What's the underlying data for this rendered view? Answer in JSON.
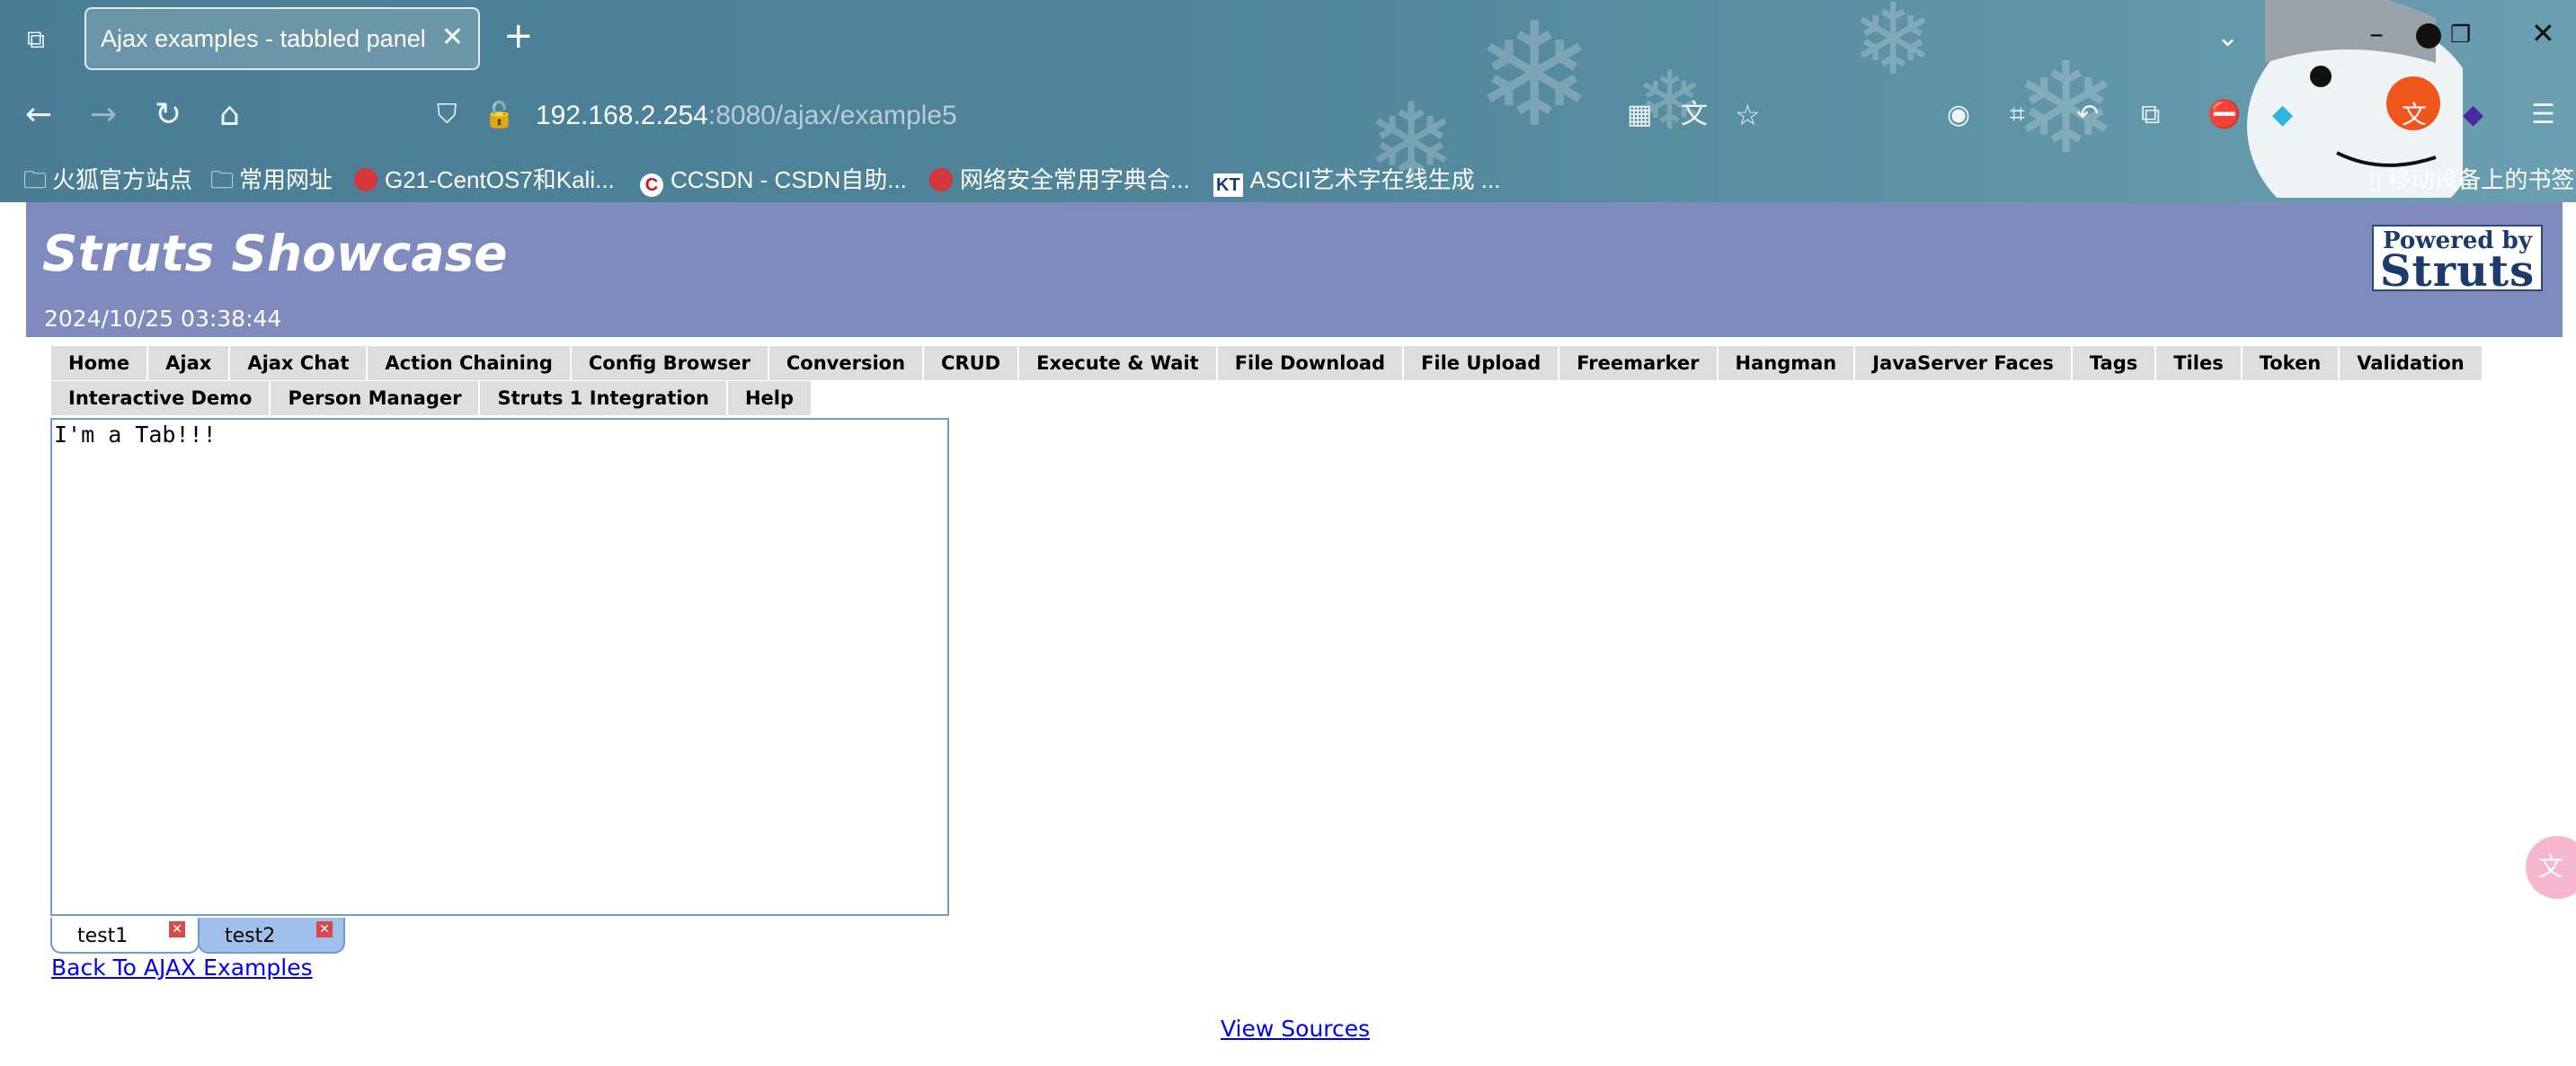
{
  "browser": {
    "tab_title": "Ajax examples - tabbled panel",
    "url_host": "192.168.2.254",
    "url_rest": ":8080/ajax/example5",
    "bookmarks": [
      {
        "label": "火狐官方站点",
        "icon": "folder-icon"
      },
      {
        "label": "常用网址",
        "icon": "folder-icon"
      },
      {
        "label": "G21-CentOS7和Kali...",
        "icon": "red-circle-icon"
      },
      {
        "label": "CCSDN - CSDN自助...",
        "icon": "csdn-icon"
      },
      {
        "label": "网络安全常用字典合...",
        "icon": "red-circle-icon"
      },
      {
        "label": "ASCII艺术字在线生成 ...",
        "icon": "kt-icon"
      }
    ],
    "mobile_bookmarks": "移动设备上的书签"
  },
  "header": {
    "title": "Struts Showcase",
    "datetime": "2024/10/25 03:38:44",
    "powered_line1": "Powered by",
    "powered_line2": "Struts"
  },
  "menu_row1": [
    "Home",
    "Ajax",
    "Ajax Chat",
    "Action Chaining",
    "Config Browser",
    "Conversion",
    "CRUD",
    "Execute & Wait",
    "File Download",
    "File Upload",
    "Freemarker",
    "Hangman",
    "JavaServer Faces",
    "Tags",
    "Tiles",
    "Token",
    "Validation"
  ],
  "menu_row2": [
    "Interactive Demo",
    "Person Manager",
    "Struts 1 Integration",
    "Help"
  ],
  "panel": {
    "content": "I'm a Tab!!!",
    "tabs": [
      {
        "label": "test1",
        "selected": true
      },
      {
        "label": "test2",
        "selected": false
      }
    ]
  },
  "links": {
    "back": "Back To AJAX Examples",
    "view_sources": "View Sources"
  },
  "colors": {
    "header_bg": "#7f8bbd",
    "menu_bg": "#dedede",
    "panel_border": "#6f9bd1",
    "inactive_tab": "#9ec0ea",
    "link": "#0000ee"
  }
}
